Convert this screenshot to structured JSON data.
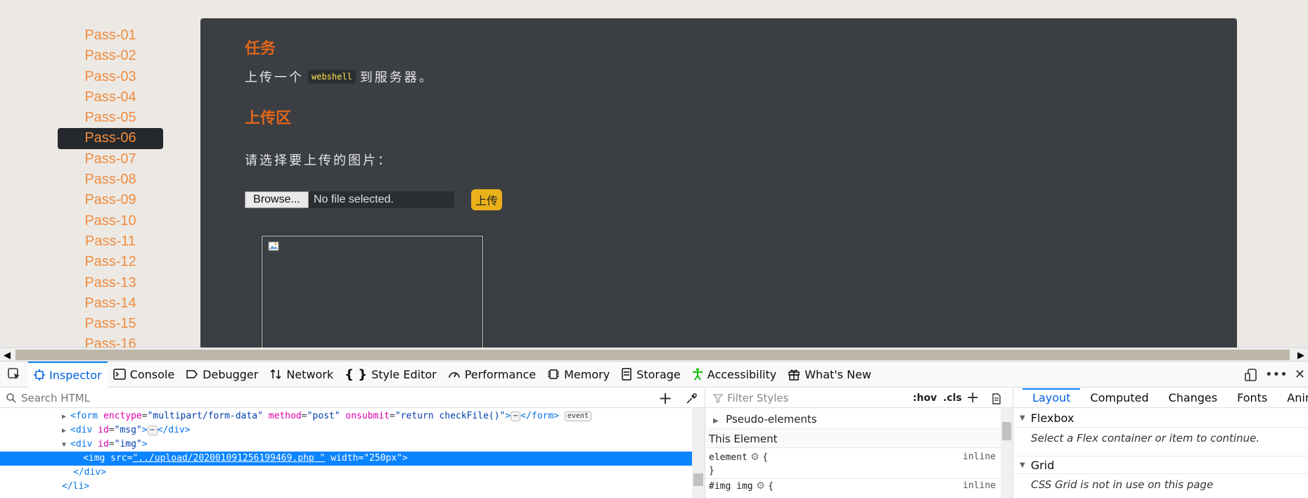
{
  "sidebar": {
    "items": [
      "Pass-01",
      "Pass-02",
      "Pass-03",
      "Pass-04",
      "Pass-05",
      "Pass-06",
      "Pass-07",
      "Pass-08",
      "Pass-09",
      "Pass-10",
      "Pass-11",
      "Pass-12",
      "Pass-13",
      "Pass-14",
      "Pass-15",
      "Pass-16"
    ],
    "active": "Pass-06"
  },
  "panel": {
    "task_title": "任务",
    "task_pre": "上传一个",
    "task_code": "webshell",
    "task_post": "到服务器。",
    "upload_title": "上传区",
    "choose_prompt": "请选择要上传的图片：",
    "browse_label": "Browse...",
    "file_status": "No file selected.",
    "upload_button": "上传"
  },
  "devtools": {
    "tabs": [
      "Inspector",
      "Console",
      "Debugger",
      "Network",
      "Style Editor",
      "Performance",
      "Memory",
      "Storage",
      "Accessibility",
      "What's New"
    ],
    "selected_tab": "Inspector",
    "search_placeholder": "Search HTML",
    "tree": {
      "form_line": {
        "tag_open": "<form ",
        "a1": "enctype",
        "v1": "\"multipart/form-data\"",
        "a2": "method",
        "v2": "\"post\"",
        "a3": "onsubmit",
        "v3": "\"return checkFile()\"",
        "tag_close": "></form>",
        "badge": "event"
      },
      "msg_line": {
        "tag_open": "<div ",
        "a1": "id",
        "v1": "\"msg\"",
        "tag_close": "></div>"
      },
      "img_div_line": {
        "tag_open": "<div ",
        "a1": "id",
        "v1": "\"img\"",
        "tag_close": ">"
      },
      "img_line": {
        "tag_open": "<img ",
        "a1": "src",
        "v1": "\"../upload/202001091256199469.php \"",
        "a2": "width",
        "v2": "\"250px\"",
        "tag_close": ">"
      },
      "div_close": "</div>",
      "li_close": "</li>"
    },
    "rules": {
      "filter_placeholder": "Filter Styles",
      "hov": ":hov",
      "cls": ".cls",
      "pseudo": "Pseudo-elements",
      "this_element": "This Element",
      "element_rule": "element",
      "brace_open": "{",
      "brace_close": "}",
      "inline": "inline",
      "img_rule": "#img img"
    },
    "layout": {
      "tabs": [
        "Layout",
        "Computed",
        "Changes",
        "Fonts",
        "Anim"
      ],
      "selected": "Layout",
      "flexbox": "Flexbox",
      "flex_msg": "Select a Flex container or item to continue.",
      "grid": "Grid",
      "grid_msg": "CSS Grid is not in use on this page"
    }
  },
  "colors": {
    "accent": "#f08c40",
    "title": "#e0661a",
    "panel_bg": "#3b3e42",
    "upload_btn": "#eab11b",
    "devtools_blue": "#0a84ff"
  }
}
